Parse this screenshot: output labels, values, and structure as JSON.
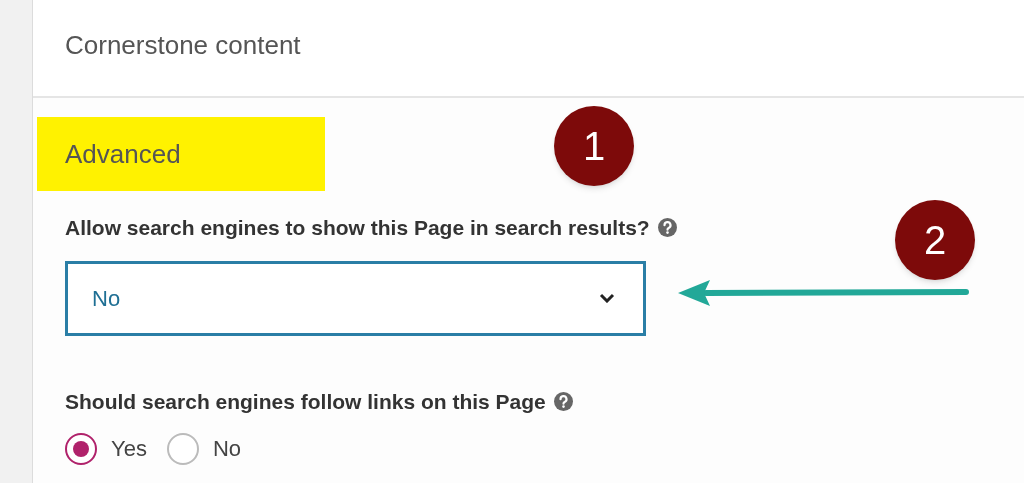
{
  "cornerstone": {
    "title": "Cornerstone content"
  },
  "advanced": {
    "title": "Advanced",
    "highlighted": true
  },
  "index_setting": {
    "label": "Allow search engines to show this Page in search results?",
    "value": "No"
  },
  "follow_setting": {
    "label": "Should search engines follow links on this Page",
    "options": [
      {
        "label": "Yes",
        "selected": true
      },
      {
        "label": "No",
        "selected": false
      }
    ]
  },
  "annotations": [
    {
      "number": "1"
    },
    {
      "number": "2"
    }
  ]
}
